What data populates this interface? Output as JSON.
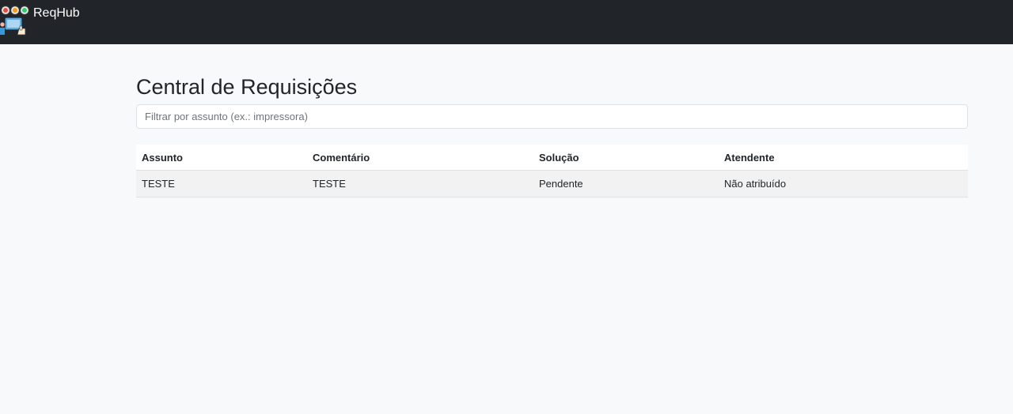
{
  "app": {
    "brand": "ReqHub"
  },
  "page": {
    "title": "Central de Requisições"
  },
  "filter": {
    "placeholder": "Filtrar por assunto (ex.: impressora)",
    "value": ""
  },
  "table": {
    "headers": {
      "assunto": "Assunto",
      "comentario": "Comentário",
      "solucao": "Solução",
      "atendente": "Atendente"
    },
    "rows": [
      {
        "assunto": "TESTE",
        "comentario": "TESTE",
        "solucao": "Pendente",
        "atendente": "Não atribuído"
      }
    ]
  },
  "icons": {
    "logo": "helpdesk-logo-icon"
  },
  "colors": {
    "navbar": "#212529",
    "background": "#f8f9fa",
    "row_striped": "#f2f2f2"
  }
}
